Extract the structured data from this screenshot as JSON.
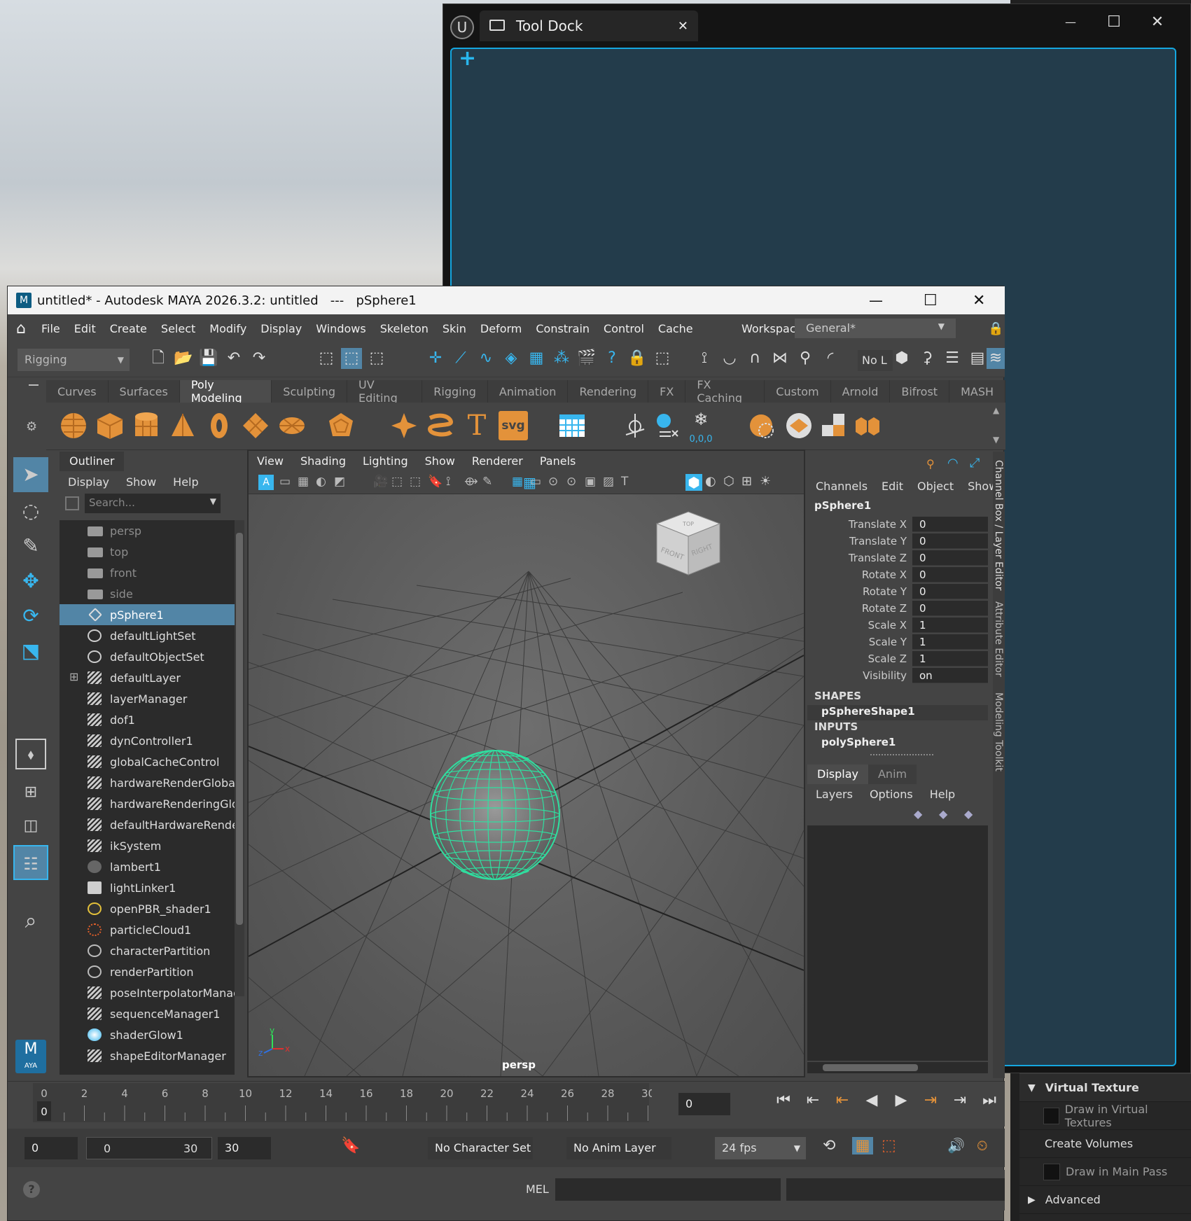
{
  "tool_dock": {
    "tab_title": "Tool Dock",
    "close_glyph": "✕",
    "add_glyph": "+",
    "min_glyph": "—",
    "max_glyph": "☐",
    "x_glyph": "✕"
  },
  "unreal_details": {
    "section_title": "Virtual Texture",
    "row1": "Draw in Virtual Textures",
    "row2": "Create Volumes",
    "row3": "Draw in Main Pass",
    "section2": "Advanced"
  },
  "maya": {
    "title": "untitled* - Autodesk MAYA 2026.3.2: untitled   ---   pSphere1",
    "menus": [
      "File",
      "Edit",
      "Create",
      "Select",
      "Modify",
      "Display",
      "Windows",
      "Skeleton",
      "Skin",
      "Deform",
      "Constrain",
      "Control",
      "Cache"
    ],
    "workspace_label": "Workspace:",
    "workspace_value": "General*",
    "mode": "Rigging",
    "no_live": "No L",
    "shelf_tabs": [
      "Curves",
      "Surfaces",
      "Poly Modeling",
      "Sculpting",
      "UV Editing",
      "Rigging",
      "Animation",
      "Rendering",
      "FX",
      "FX Caching",
      "Custom",
      "Arnold",
      "Bifrost",
      "MASH"
    ],
    "active_shelf": "Poly Modeling",
    "shelf_text_icons": {
      "t": "T",
      "svg": "svg",
      "zero": "0,0,0"
    },
    "outliner": {
      "title": "Outliner",
      "menus": [
        "Display",
        "Show",
        "Help"
      ],
      "search_placeholder": "Search...",
      "items": [
        "persp",
        "top",
        "front",
        "side",
        "pSphere1",
        "defaultLightSet",
        "defaultObjectSet",
        "defaultLayer",
        "layerManager",
        "dof1",
        "dynController1",
        "globalCacheControl",
        "hardwareRenderGloba",
        "hardwareRenderingGlo",
        "defaultHardwareRende",
        "ikSystem",
        "lambert1",
        "lightLinker1",
        "openPBR_shader1",
        "particleCloud1",
        "characterPartition",
        "renderPartition",
        "poseInterpolatorManag",
        "sequenceManager1",
        "shaderGlow1",
        "shapeEditorManager"
      ]
    },
    "viewport": {
      "menus": [
        "View",
        "Shading",
        "Lighting",
        "Show",
        "Renderer",
        "Panels"
      ],
      "camera_label": "persp",
      "cube_top": "TOP",
      "cube_front": "FRONT",
      "cube_right": "RIGHT",
      "axis_x": "x",
      "axis_y": "y",
      "axis_z": "z"
    },
    "channel_box": {
      "menus": [
        "Channels",
        "Edit",
        "Object",
        "Show"
      ],
      "object": "pSphere1",
      "attrs": [
        {
          "name": "Translate X",
          "value": "0"
        },
        {
          "name": "Translate Y",
          "value": "0"
        },
        {
          "name": "Translate Z",
          "value": "0"
        },
        {
          "name": "Rotate X",
          "value": "0"
        },
        {
          "name": "Rotate Y",
          "value": "0"
        },
        {
          "name": "Rotate Z",
          "value": "0"
        },
        {
          "name": "Scale X",
          "value": "1"
        },
        {
          "name": "Scale Y",
          "value": "1"
        },
        {
          "name": "Scale Z",
          "value": "1"
        },
        {
          "name": "Visibility",
          "value": "on"
        }
      ],
      "shapes_label": "SHAPES",
      "shape": "pSphereShape1",
      "inputs_label": "INPUTS",
      "input": "polySphere1",
      "layer_tabs": [
        "Display",
        "Anim"
      ],
      "layer_menus": [
        "Layers",
        "Options",
        "Help"
      ]
    },
    "side_tabs": [
      "Channel Box / Layer Editor",
      "Attribute Editor",
      "Modeling Toolkit"
    ],
    "timeline": {
      "ticks": [
        "0",
        "2",
        "4",
        "6",
        "8",
        "10",
        "12",
        "14",
        "16",
        "18",
        "20",
        "22",
        "24",
        "26",
        "28",
        "30"
      ],
      "current_frame_marker": "0",
      "current_frame": "0"
    },
    "range": {
      "start": "0",
      "inner_start": "0",
      "inner_end": "30",
      "end": "30",
      "character_set": "No Character Set",
      "anim_layer": "No Anim Layer",
      "fps": "24 fps"
    },
    "cmd": {
      "lang": "MEL",
      "help_glyph": "?"
    },
    "logo_text": "M",
    "logo_sub": "AYA"
  },
  "colors": {
    "accent": "#15a7e0",
    "selection": "#5285a6",
    "wire": "#2fe0a0",
    "shelf_orange": "#e3923a"
  }
}
